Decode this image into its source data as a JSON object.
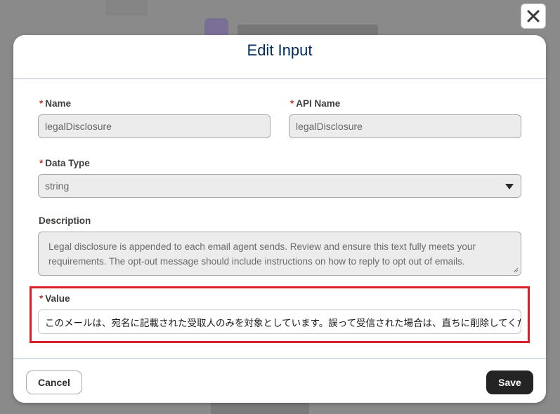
{
  "modal": {
    "title": "Edit Input",
    "required_marker": "*"
  },
  "fields": {
    "name": {
      "label": "Name",
      "value": "legalDisclosure"
    },
    "api_name": {
      "label": "API Name",
      "value": "legalDisclosure"
    },
    "data_type": {
      "label": "Data Type",
      "value": "string"
    },
    "description": {
      "label": "Description",
      "value": "Legal disclosure is appended to each email agent sends. Review and ensure this text fully meets your requirements. The opt-out message should include instructions on how to reply to opt out of emails."
    },
    "value": {
      "label": "Value",
      "value": "このメールは、宛名に記載された受取人のみを対象としています。誤って受信された場合は、直ちに削除してください。"
    }
  },
  "footer": {
    "cancel_label": "Cancel",
    "save_label": "Save"
  },
  "icons": {
    "close": "close-icon",
    "dropdown": "chevron-down-icon",
    "resize": "resize-handle-icon"
  },
  "colors": {
    "title": "#032d60",
    "required": "#c23934",
    "highlight": "#d9202a",
    "save_button": "#242424"
  }
}
